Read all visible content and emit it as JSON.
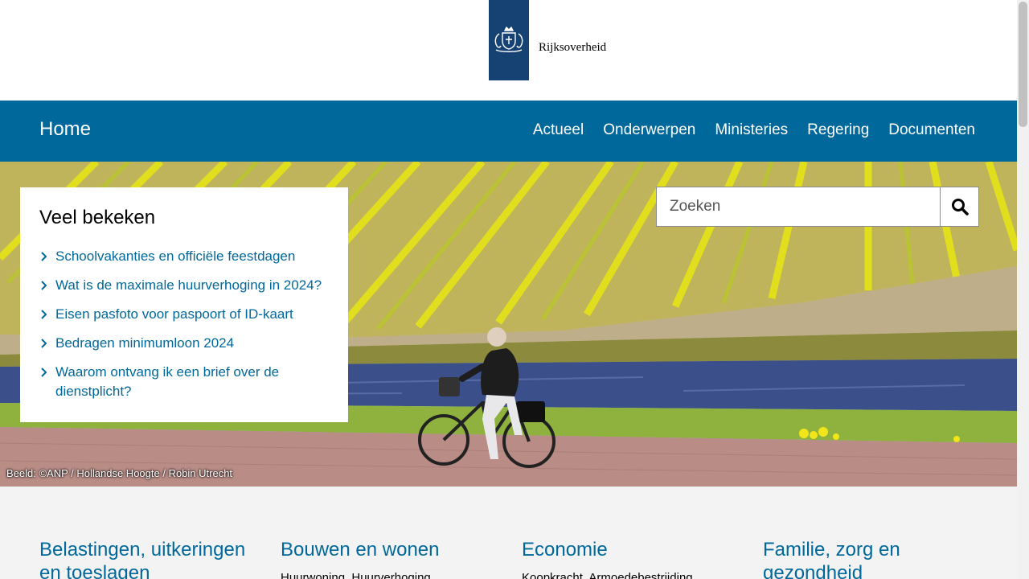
{
  "header": {
    "logo_text": "Rijksoverheid",
    "logo_icon": "coat-of-arms-icon"
  },
  "nav": {
    "home": "Home",
    "items": [
      "Actueel",
      "Onderwerpen",
      "Ministeries",
      "Regering",
      "Documenten"
    ]
  },
  "popular": {
    "title": "Veel bekeken",
    "links": [
      "Schoolvakanties en officiële feestdagen",
      "Wat is de maximale huurverhoging in 2024?",
      "Eisen pasfoto voor paspoort of ID-kaart",
      "Bedragen minimumloon 2024",
      "Waarom ontvang ik een brief over de dienstplicht?"
    ]
  },
  "search": {
    "placeholder": "Zoeken",
    "value": "",
    "icon": "search-icon"
  },
  "hero": {
    "credit": "Beeld: ©ANP / Hollandse Hoogte / Robin Utrecht"
  },
  "topics": [
    {
      "title": "Belastingen, uitkeringen en toeslagen",
      "sub": ""
    },
    {
      "title": "Bouwen en wonen",
      "sub": "Huurwoning, Huurverhoging"
    },
    {
      "title": "Economie",
      "sub": "Koopkracht, Armoedebestrijding"
    },
    {
      "title": "Familie, zorg en gezondheid",
      "sub": ""
    }
  ],
  "colors": {
    "brand_blue": "#01689b",
    "logo_blue": "#154273",
    "link": "#01689b"
  }
}
